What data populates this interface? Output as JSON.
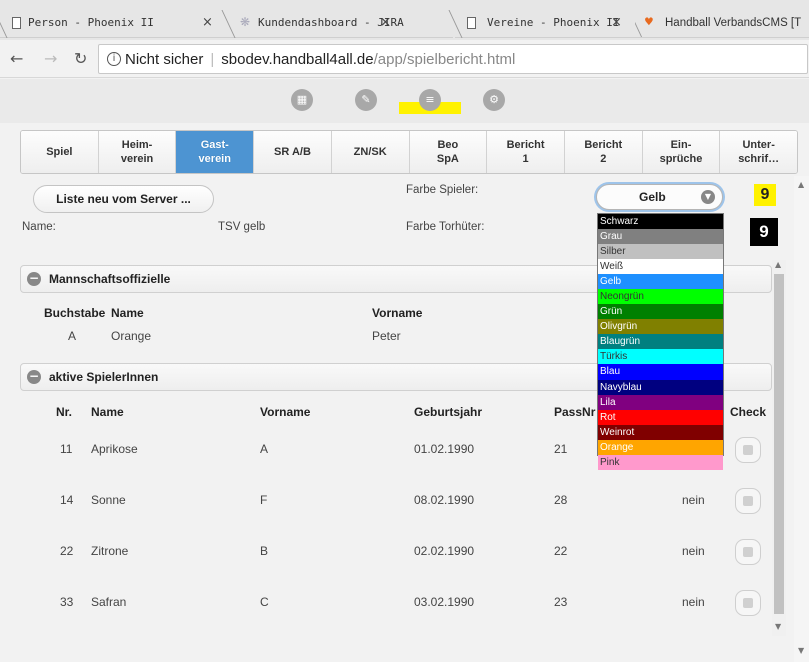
{
  "browser": {
    "tabs": [
      {
        "title": "Person - Phoenix II",
        "icon": "doc-icon"
      },
      {
        "title": "Kundendashboard - JIRA",
        "icon": "jira-icon"
      },
      {
        "title": "Vereine - Phoenix II",
        "icon": "doc-icon"
      },
      {
        "title": "Handball VerbandsCMS [T",
        "icon": "shield-icon"
      }
    ],
    "close_glyph": "×",
    "address": {
      "security_label": "Nicht sicher",
      "host": "sbodev.handball4all.de",
      "path": "/app/spielbericht.html"
    }
  },
  "app": {
    "header_icons": [
      "grid-icon",
      "pencil-icon",
      "list-icon",
      "settings-icon"
    ],
    "highlight_color": "#fff200"
  },
  "tabs": [
    {
      "label": "Spiel",
      "active": false
    },
    {
      "label": "Heim-\nverein",
      "active": false
    },
    {
      "label": "Gast-\nverein",
      "active": true
    },
    {
      "label": "SR A/B",
      "active": false
    },
    {
      "label": "ZN/SK",
      "active": false
    },
    {
      "label": "Beo\nSpA",
      "active": false
    },
    {
      "label": "Bericht\n1",
      "active": false
    },
    {
      "label": "Bericht\n2",
      "active": false
    },
    {
      "label": "Ein-\nsprüche",
      "active": false
    },
    {
      "label": "Unter-\nschrif…",
      "active": false
    }
  ],
  "team": {
    "reload_button": "Liste neu vom Server ...",
    "name_label": "Name:",
    "name_value": "TSV gelb",
    "player_color_label": "Farbe Spieler:",
    "keeper_color_label": "Farbe Torhüter:",
    "selected_color": "Gelb",
    "player_number": "9",
    "keeper_number": "9"
  },
  "colors": [
    {
      "name": "Schwarz",
      "bg": "#000000",
      "fg": "#ffffff"
    },
    {
      "name": "Grau",
      "bg": "#808080",
      "fg": "#ffffff"
    },
    {
      "name": "Silber",
      "bg": "#c0c0c0",
      "fg": "#333333"
    },
    {
      "name": "Weiß",
      "bg": "#ffffff",
      "fg": "#333333"
    },
    {
      "name": "Gelb",
      "bg": "#1e90ff",
      "fg": "#ffffff"
    },
    {
      "name": "Neongrün",
      "bg": "#00ff00",
      "fg": "#333333"
    },
    {
      "name": "Grün",
      "bg": "#008000",
      "fg": "#ffffff"
    },
    {
      "name": "Olivgrün",
      "bg": "#808000",
      "fg": "#ffffff"
    },
    {
      "name": "Blaugrün",
      "bg": "#008080",
      "fg": "#ffffff"
    },
    {
      "name": "Türkis",
      "bg": "#00ffff",
      "fg": "#333333"
    },
    {
      "name": "Blau",
      "bg": "#0000ff",
      "fg": "#ffffff"
    },
    {
      "name": "Navyblau",
      "bg": "#000080",
      "fg": "#ffffff"
    },
    {
      "name": "Lila",
      "bg": "#800080",
      "fg": "#ffffff"
    },
    {
      "name": "Rot",
      "bg": "#ff0000",
      "fg": "#ffffff"
    },
    {
      "name": "Weinrot",
      "bg": "#800000",
      "fg": "#ffffff"
    },
    {
      "name": "Orange",
      "bg": "#ffa500",
      "fg": "#ffffff"
    },
    {
      "name": "Pink",
      "bg": "#ff99cc",
      "fg": "#333333"
    }
  ],
  "officials": {
    "title": "Mannschaftsoffizielle",
    "columns": [
      "Buchstabe",
      "Name",
      "Vorname"
    ],
    "rows": [
      {
        "letter": "A",
        "name": "Orange",
        "firstname": "Peter"
      }
    ]
  },
  "players": {
    "title": "aktive SpielerInnen",
    "columns": [
      "Nr.",
      "Name",
      "Vorname",
      "Geburtsjahr",
      "PassNr",
      "Check"
    ],
    "rows": [
      {
        "nr": "11",
        "name": "Aprikose",
        "firstname": "A",
        "birth": "01.02.1990",
        "pass": "21",
        "status": ""
      },
      {
        "nr": "14",
        "name": "Sonne",
        "firstname": "F",
        "birth": "08.02.1990",
        "pass": "28",
        "status": "nein"
      },
      {
        "nr": "22",
        "name": "Zitrone",
        "firstname": "B",
        "birth": "02.02.1990",
        "pass": "22",
        "status": "nein"
      },
      {
        "nr": "33",
        "name": "Safran",
        "firstname": "C",
        "birth": "03.02.1990",
        "pass": "23",
        "status": "nein"
      }
    ]
  }
}
